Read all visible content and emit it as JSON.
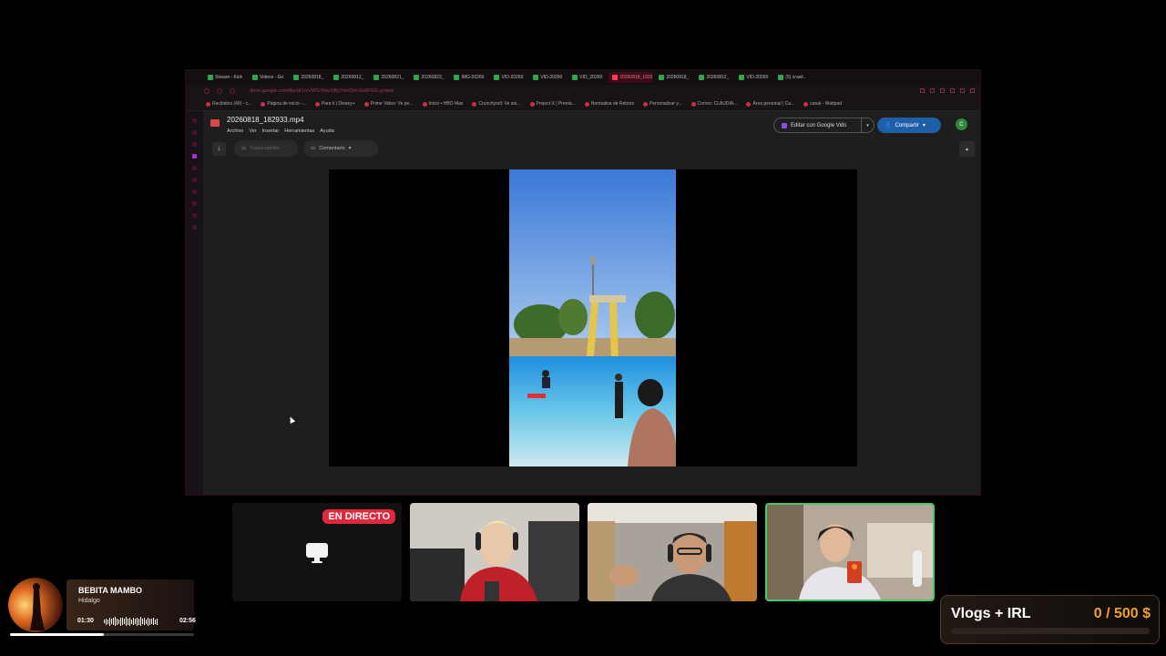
{
  "browser": {
    "tabs": [
      {
        "label": "Stream - Kick",
        "active": false
      },
      {
        "label": "Videos - Go",
        "active": false
      },
      {
        "label": "20260818_",
        "active": false
      },
      {
        "label": "20260812_",
        "active": false
      },
      {
        "label": "20260821_",
        "active": false
      },
      {
        "label": "20260823_",
        "active": false
      },
      {
        "label": "IMG-20260",
        "active": false
      },
      {
        "label": "VID-20260",
        "active": false
      },
      {
        "label": "VID-20260",
        "active": false
      },
      {
        "label": "VID_20260",
        "active": false
      },
      {
        "label": "20260818_182933.m",
        "active": true
      },
      {
        "label": "20260818_",
        "active": false
      },
      {
        "label": "20260812_",
        "active": false
      },
      {
        "label": "VID-20260",
        "active": false
      },
      {
        "label": "(5) crawl..",
        "active": false
      }
    ],
    "url": "drive.google.com/file/d/1rvVWS7Hw1tByYHrCbm3o6FGG-g/view",
    "bookmarks": [
      "Recibidos (49) - c...",
      "Página de inicio -...",
      "Para ti | Disney+",
      "Prime Video: Ve pe...",
      "Inicio • HBO Max",
      "Crunchyroll: Ve ani...",
      "Project X | Prenta...",
      "Normativa de Rebors",
      "Personalizar y...",
      "Correo: CLAUDIA...",
      "Área personal | Ca...",
      "canal - Wattpad"
    ]
  },
  "drive": {
    "file_title": "20260818_182933.mp4",
    "menu": [
      "Archivo",
      "Ver",
      "Insertar",
      "Herramientas",
      "Ayuda"
    ],
    "edit_vids_label": "Editar con Google Vids",
    "share_label": "Compartir",
    "account_initial": "C",
    "transcription_label": "Transcripción",
    "comment_label": "Comentario"
  },
  "stream": {
    "live_badge": "EN DIRECTO"
  },
  "music": {
    "song": "BEBITA MAMBO",
    "artist": "Hidalgo",
    "elapsed": "01:30",
    "duration": "02:56",
    "progress_fraction": 0.51
  },
  "goal": {
    "title": "Vlogs + IRL",
    "value": "0 / 500 $",
    "current": 0,
    "target": 500
  },
  "colors": {
    "live": "#e0283c",
    "goal_accent": "#f0a030",
    "active_cam_border": "#46c86a",
    "share_button": "#1f5fa8"
  }
}
